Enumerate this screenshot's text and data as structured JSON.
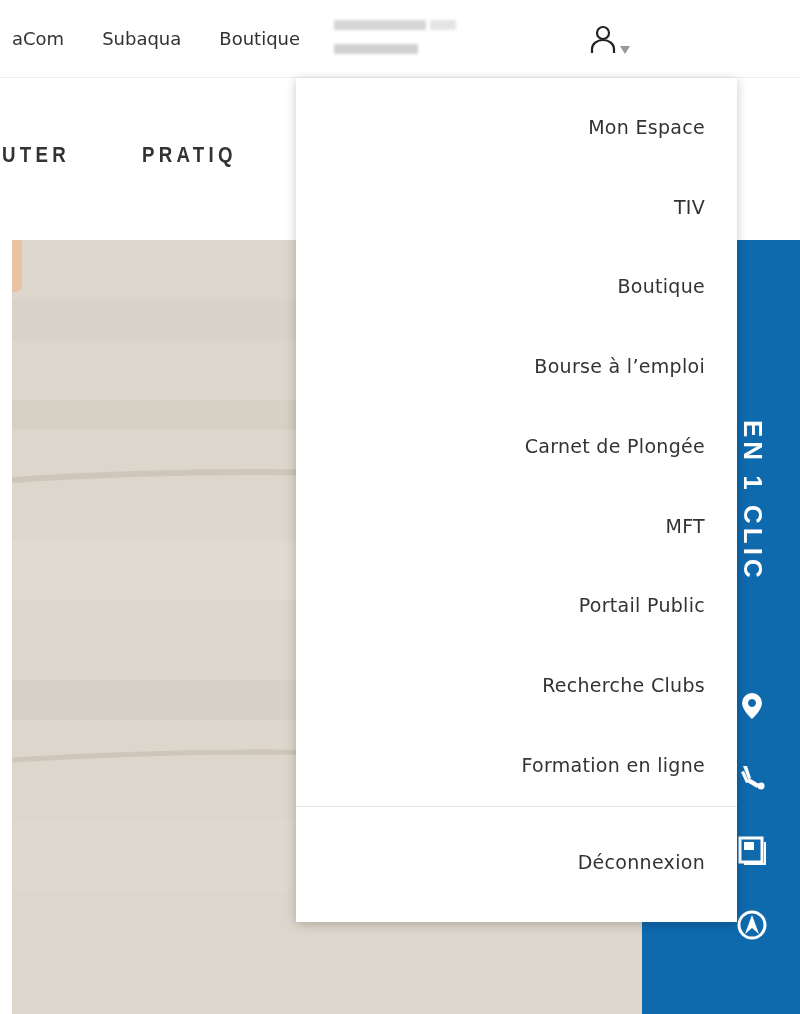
{
  "top_nav": {
    "links": [
      {
        "label": "aCom"
      },
      {
        "label": "Subaqua"
      },
      {
        "label": "Boutique"
      }
    ]
  },
  "main_nav": {
    "links": [
      {
        "label": "UTER"
      },
      {
        "label": "PRATIQ"
      }
    ]
  },
  "user_menu": {
    "expanded": true,
    "items": [
      {
        "label": "Mon Espace"
      },
      {
        "label": "TIV"
      },
      {
        "label": "Boutique"
      },
      {
        "label": "Bourse à l’emploi"
      },
      {
        "label": "Carnet de Plongée"
      },
      {
        "label": "MFT"
      },
      {
        "label": "Portail Public"
      },
      {
        "label": "Recherche Clubs"
      },
      {
        "label": "Formation en ligne"
      }
    ],
    "logout": "Déconnexion"
  },
  "side_panel": {
    "title": "EN 1 CLIC"
  }
}
